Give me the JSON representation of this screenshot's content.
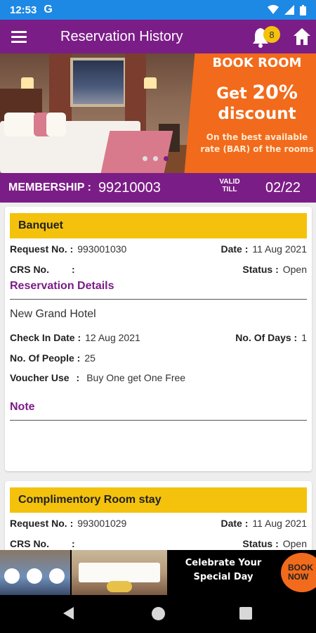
{
  "status_bar": {
    "time": "12:53",
    "app_icon": "G"
  },
  "app_bar": {
    "title": "Reservation History",
    "notification_count": "8"
  },
  "banner": {
    "promo_heading": "BOOK ROOM",
    "promo_get": "Get",
    "promo_percent": "20%",
    "promo_discount": "discount",
    "promo_line1": "On the best available",
    "promo_line2": "rate (BAR) of the rooms",
    "active_slide": 3,
    "slide_count": 3
  },
  "membership": {
    "label": "MEMBERSHIP :",
    "number": "99210003",
    "valid_label_1": "VALID",
    "valid_label_2": "TILL",
    "valid_till": "02/22"
  },
  "labels": {
    "request_no": "Request No. :",
    "date": "Date :",
    "crs_no": "CRS No.",
    "crs_colon": ":",
    "status": "Status :",
    "reservation_details": "Reservation Details",
    "check_in_date": "Check In Date :",
    "no_of_days": "No. Of Days :",
    "no_of_people": "No. Of People :",
    "voucher_use": "Voucher Use",
    "voucher_colon": ":",
    "note": "Note"
  },
  "reservations": [
    {
      "type": "Banquet",
      "request_no": "993001030",
      "date": "11 Aug 2021",
      "crs_no": "",
      "status": "Open",
      "hotel": "New Grand Hotel",
      "check_in_date": "12 Aug 2021",
      "no_of_days": "1",
      "no_of_people": "25",
      "voucher_use": "Buy One get One Free",
      "note": ""
    },
    {
      "type": "Complimentory Room stay",
      "request_no": "993001029",
      "date": "11 Aug 2021",
      "crs_no": "",
      "status": "Open"
    }
  ],
  "ad": {
    "line1": "Celebrate Your",
    "line2": "Special Day",
    "button_line1": "BOOK",
    "button_line2": "NOW"
  },
  "colors": {
    "status_bar": "#1e88e5",
    "primary": "#7b1d87",
    "accent": "#f4c20d",
    "promo": "#f26a1b"
  },
  "icons": {
    "menu": "menu-icon",
    "bell": "bell-icon",
    "home": "home-icon",
    "wifi": "wifi-icon",
    "signal": "signal-icon",
    "battery": "battery-icon"
  }
}
